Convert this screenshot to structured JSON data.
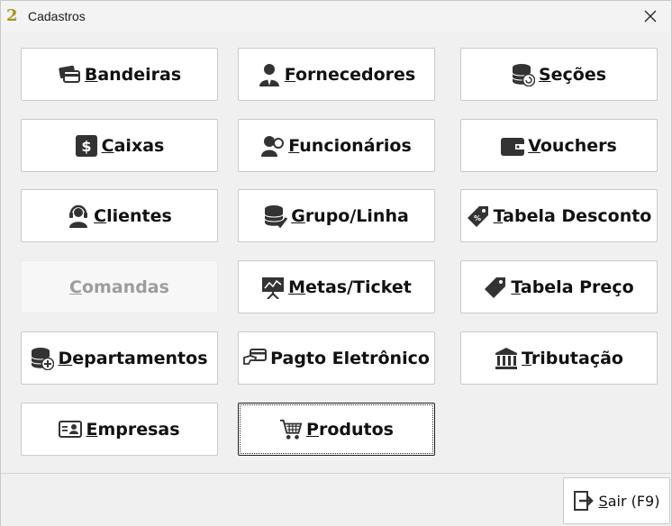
{
  "window": {
    "title": "Cadastros",
    "close_glyph": "✕"
  },
  "buttons": [
    {
      "first": "B",
      "rest": "andeiras",
      "icon": "credit-cards-icon"
    },
    {
      "first": "F",
      "rest": "ornecedores",
      "icon": "supplier-person-icon"
    },
    {
      "first": "S",
      "rest": "eções",
      "icon": "database-refresh-icon"
    },
    {
      "first": "C",
      "rest": "aixas",
      "icon": "dollar-box-icon"
    },
    {
      "first": "F",
      "rest": "uncionários",
      "icon": "employee-icon"
    },
    {
      "first": "V",
      "rest": "ouchers",
      "icon": "wallet-icon"
    },
    {
      "first": "C",
      "rest": "lientes",
      "icon": "customer-headset-icon"
    },
    {
      "first": "G",
      "rest": "rupo/Linha",
      "icon": "database-check-icon"
    },
    {
      "first": "T",
      "rest": "abela Desconto",
      "icon": "discount-tag-icon"
    },
    {
      "first": "C",
      "rest": "omandas",
      "icon": "",
      "disabled": true
    },
    {
      "first": "M",
      "rest": "etas/Ticket",
      "icon": "presentation-chart-icon"
    },
    {
      "first": "T",
      "rest": "abela Preço",
      "icon": "price-tag-icon"
    },
    {
      "first": "D",
      "rest": "epartamentos",
      "icon": "database-add-icon"
    },
    {
      "first": "",
      "rest": "Pagto Eletrônico",
      "icon": "card-payment-icon"
    },
    {
      "first": "T",
      "rest": "ributação",
      "icon": "bank-icon"
    },
    {
      "first": "E",
      "rest": "mpresas",
      "icon": "company-id-icon"
    },
    {
      "first": "P",
      "rest": "rodutos",
      "icon": "cart-icon",
      "focused": true
    }
  ],
  "footer": {
    "exit_first": "S",
    "exit_rest": "air (F9)",
    "exit_icon": "exit-icon"
  }
}
